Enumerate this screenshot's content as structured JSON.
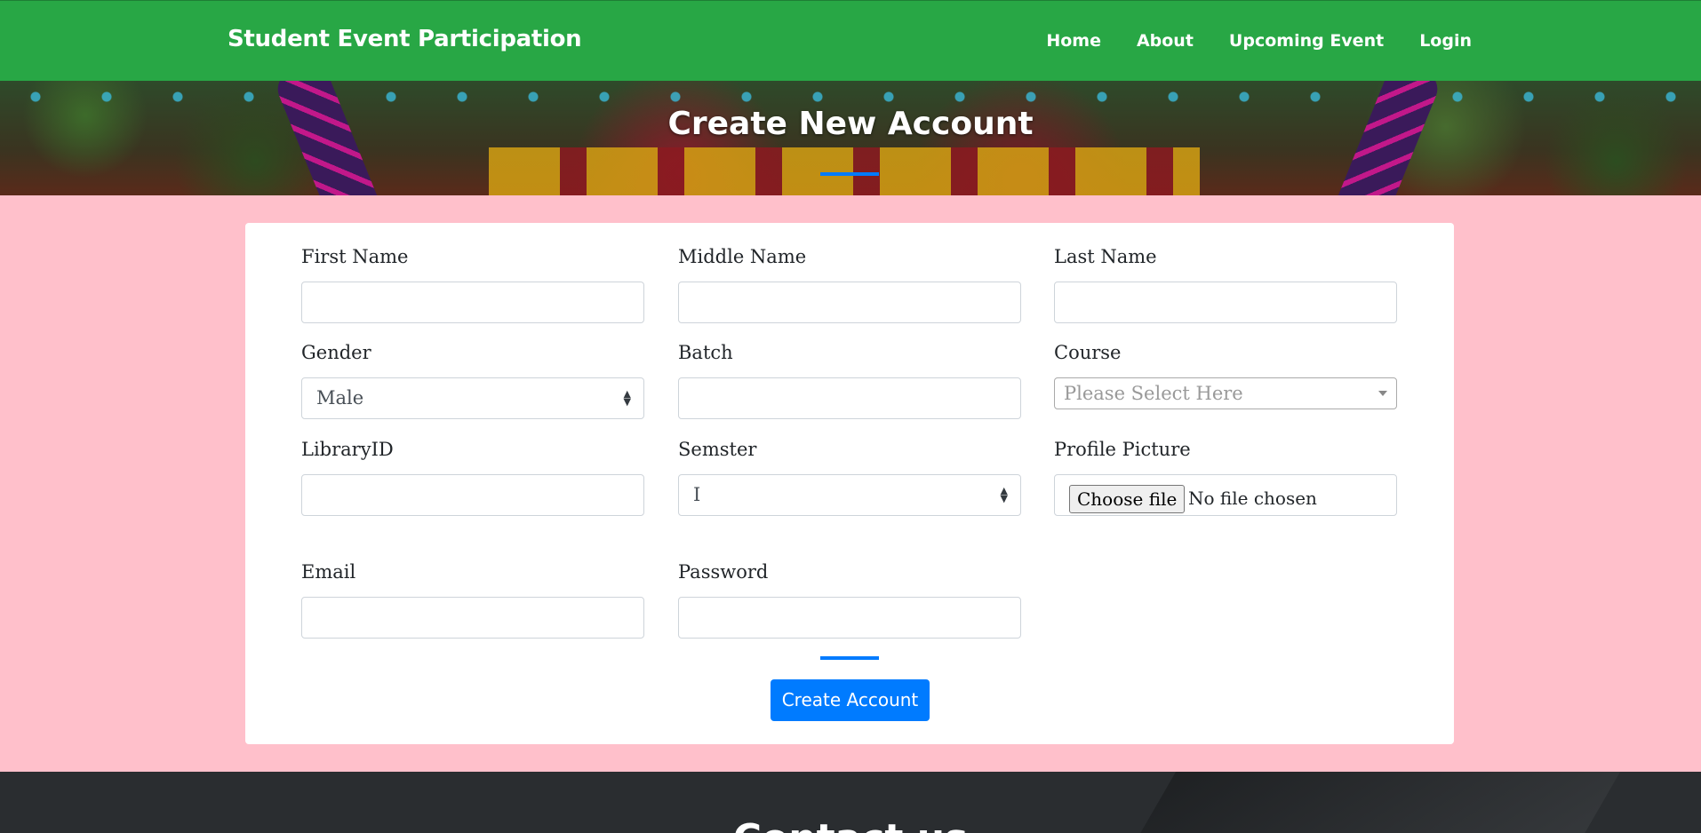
{
  "navbar": {
    "brand": "Student Event Participation",
    "links": [
      "Home",
      "About",
      "Upcoming Event",
      "Login"
    ],
    "color": "#28a745"
  },
  "hero": {
    "title": "Create New Account"
  },
  "form": {
    "first_name": {
      "label": "First Name",
      "value": ""
    },
    "middle_name": {
      "label": "Middle Name",
      "value": ""
    },
    "last_name": {
      "label": "Last Name",
      "value": ""
    },
    "gender": {
      "label": "Gender",
      "selected": "Male"
    },
    "batch": {
      "label": "Batch",
      "value": ""
    },
    "course": {
      "label": "Course",
      "placeholder": "Please Select Here"
    },
    "library_id": {
      "label": "LibraryID",
      "value": ""
    },
    "semester": {
      "label": "Semster",
      "selected": "I"
    },
    "profile_picture": {
      "label": "Profile Picture",
      "button": "Choose file",
      "status": "No file chosen"
    },
    "email": {
      "label": "Email",
      "value": ""
    },
    "password": {
      "label": "Password",
      "value": ""
    },
    "submit_label": "Create Account",
    "accent_color": "#007bff",
    "background_color": "#ffc0cb"
  },
  "footer": {
    "title": "Contact us"
  }
}
